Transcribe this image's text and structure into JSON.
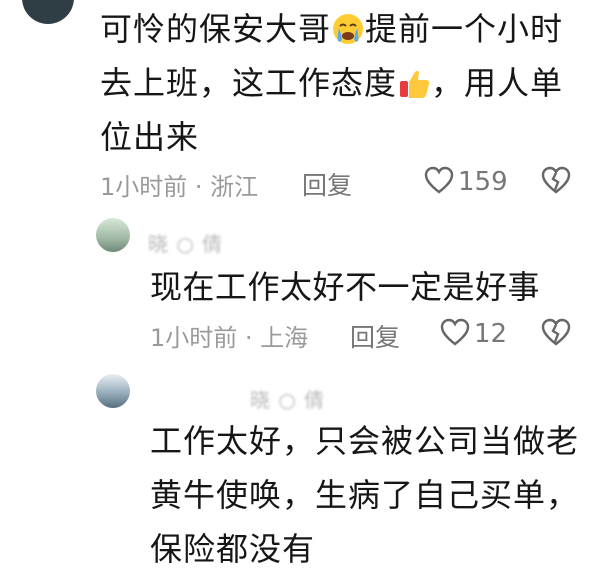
{
  "comments": [
    {
      "text_line1_a": "可怜的保安大哥",
      "emoji1": "crying-face",
      "text_line1_b": "提前一个小时",
      "text_line2_a": "去上班，这工作态度",
      "emoji2": "thumbs-up",
      "text_line2_b": "，用人单",
      "text_line3": "位出来",
      "time_location": "1小时前 · 浙江",
      "reply_label": "回复",
      "likes": "159"
    },
    {
      "username": "晓 ○ 倩",
      "text": "现在工作太好不一定是好事",
      "time_location": "1小时前 · 上海",
      "reply_label": "回复",
      "likes": "12"
    },
    {
      "username": "晓 ○ 倩",
      "text_line1": "工作太好，只会被公司当做老",
      "text_line2": "黄牛使唤，生病了自己买单，",
      "text_line3": "保险都没有"
    }
  ]
}
